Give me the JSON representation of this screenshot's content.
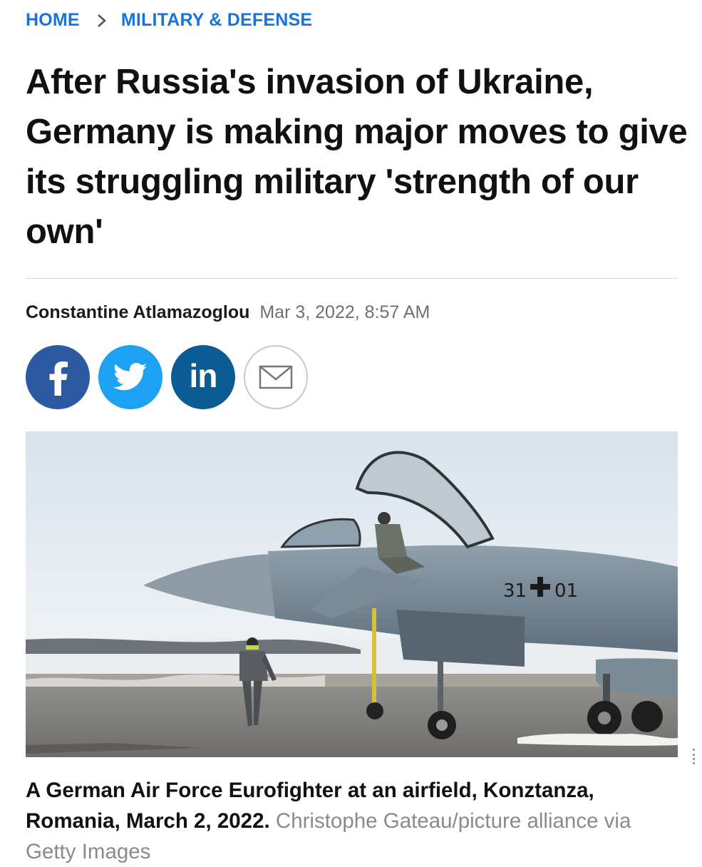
{
  "breadcrumb": {
    "home": "HOME",
    "section": "MILITARY & DEFENSE"
  },
  "article": {
    "headline": "After Russia's invasion of Ukraine, Germany is making major moves to give its struggling military 'strength of our own'",
    "author": "Constantine Atlamazoglou",
    "date": "Mar 3, 2022, 8:57 AM"
  },
  "share": {
    "icons": [
      "facebook-icon",
      "twitter-icon",
      "linkedin-icon",
      "email-icon"
    ],
    "colors": {
      "facebook": "#2c5aa0",
      "twitter": "#1da1f2",
      "linkedin": "#0b5b94",
      "email_border": "#c9c9c9"
    },
    "linkedin_text": "in"
  },
  "photo": {
    "tail_marking": "31",
    "tail_marking_2": "01"
  },
  "caption": {
    "text": "A German Air Force Eurofighter at an airfield, Konztanza, Romania, March 2, 2022.",
    "credit": "Christophe Gateau/picture alliance via Getty Images"
  },
  "colors": {
    "link": "#1a73d9",
    "headline": "#111111",
    "muted": "#6f6f6f"
  }
}
